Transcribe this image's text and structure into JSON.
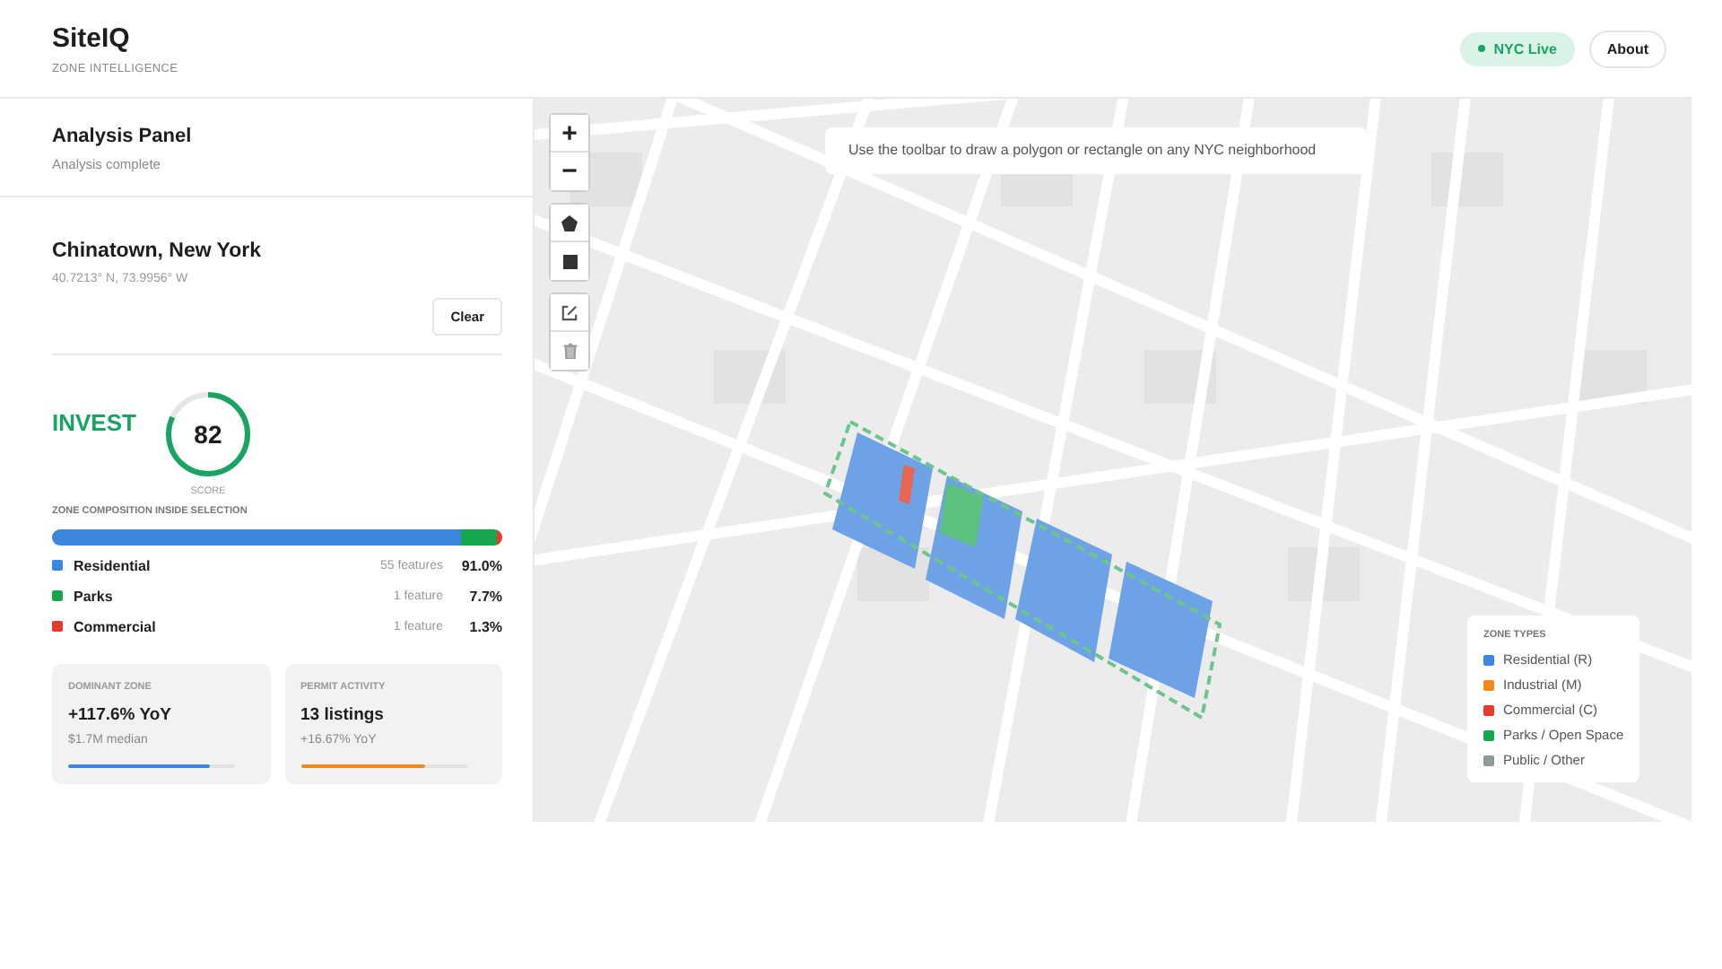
{
  "header": {
    "title": "SiteIQ",
    "subtitle": "ZONE INTELLIGENCE",
    "status": {
      "label": "NYC Live",
      "color": "#1aa463"
    },
    "about": "About"
  },
  "panel": {
    "title": "Analysis Panel",
    "status": "Analysis complete"
  },
  "location": {
    "name": "Chinatown, New York",
    "coords": "40.7213° N, 73.9956° W",
    "clear": "Clear"
  },
  "score": {
    "verdict": "INVEST",
    "value": "82",
    "level": 0.82,
    "label": "SCORE"
  },
  "composition": {
    "title": "ZONE COMPOSITION INSIDE SELECTION",
    "items": [
      {
        "name": "Residential",
        "count": "55 features",
        "percent": "91.0%",
        "level": 0.91,
        "color": "#3d86e0"
      },
      {
        "name": "Parks",
        "count": "1 feature",
        "percent": "7.7%",
        "level": 0.077,
        "color": "#17a84f"
      },
      {
        "name": "Commercial",
        "count": "1 feature",
        "percent": "1.3%",
        "level": 0.013,
        "color": "#e53b2f"
      }
    ]
  },
  "cards": [
    {
      "label": "DOMINANT ZONE",
      "value": "+117.6% YoY",
      "detail": "$1.7M median",
      "level": 0.85,
      "color": "#3d86e0"
    },
    {
      "label": "PERMIT ACTIVITY",
      "value": "13 listings",
      "detail": "+16.67% YoY",
      "level": 0.75,
      "color": "#f08a1c"
    }
  ],
  "map": {
    "hint": "Use the toolbar to draw a polygon or rectangle on any NYC neighborhood",
    "zoom_in": "+",
    "zoom_out": "−",
    "legend": {
      "title": "ZONE TYPES",
      "items": [
        {
          "name": "Residential (R)",
          "color": "#3d86e0"
        },
        {
          "name": "Industrial (M)",
          "color": "#ef8a17"
        },
        {
          "name": "Commercial (C)",
          "color": "#e53b2f"
        },
        {
          "name": "Parks / Open Space",
          "color": "#17a84f"
        },
        {
          "name": "Public / Other",
          "color": "#8e9a98"
        }
      ]
    }
  }
}
